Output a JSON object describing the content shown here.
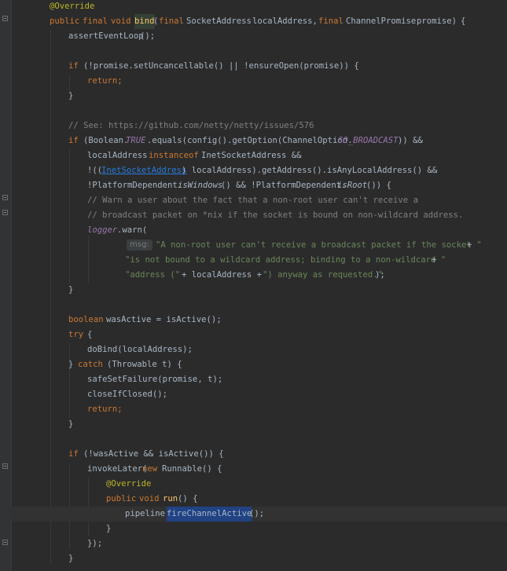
{
  "editor": {
    "l01": {
      "ann": "@Override"
    },
    "l02": {
      "kw_public": "public",
      "kw_final": "final",
      "kw_void": "void",
      "method": "bind",
      "paren": "(",
      "kw_final2": "final",
      "type1": "SocketAddress",
      "param1": "localAddress,",
      "kw_final3": "final",
      "type2": "ChannelPromise",
      "param2": "promise)",
      "brace": "{"
    },
    "l03": {
      "text": "assertEventLoop",
      "tail": "();"
    },
    "l05": {
      "kw_if": "if",
      "text": "(!promise.setUncancellable() || !ensureOpen(promise)) {"
    },
    "l06": {
      "kw_return": "return;"
    },
    "l07": {
      "brace": "}"
    },
    "l09": {
      "comment": "// See: https://github.com/netty/netty/issues/576"
    },
    "l10": {
      "kw_if": "if",
      "p1": "(Boolean.",
      "const1": "TRUE",
      "p2": ".equals(config().getOption(ChannelOption.",
      "const2": "SO_BROADCAST",
      "p3": ")) &&"
    },
    "l11": {
      "p1": "localAddress",
      "kw": "instanceof",
      "p2": "InetSocketAddress &&"
    },
    "l12": {
      "p1": "!((",
      "link": "InetSocketAddress",
      "p2": ") localAddress).getAddress().isAnyLocalAddress() &&"
    },
    "l13": {
      "p1": "!PlatformDependent.",
      "m1": "isWindows",
      "p2": "() && !PlatformDependent.",
      "m2": "isRoot",
      "p3": "()) {"
    },
    "l14": {
      "comment": "// Warn a user about the fact that a non-root user can't receive a"
    },
    "l15": {
      "comment": "// broadcast packet on *nix if the socket is bound on non-wildcard address."
    },
    "l16": {
      "field": "logger",
      "p1": ".warn("
    },
    "l17": {
      "hint": "msg:",
      "str": "\"A non-root user can't receive a broadcast packet if the socket \"",
      "op": "+"
    },
    "l18": {
      "str": "\"is not bound to a wildcard address; binding to a non-wildcard \"",
      "op": "+"
    },
    "l19": {
      "str1": "\"address (\"",
      "mid": "+ localAddress +",
      "str2": "\") anyway as requested.\"",
      "end": ");"
    },
    "l20": {
      "brace": "}"
    },
    "l22": {
      "kw": "boolean",
      "text": "wasActive = isActive();"
    },
    "l23": {
      "kw": "try",
      "brace": "{"
    },
    "l24": {
      "text": "doBind(localAddress);"
    },
    "l25": {
      "p1": "}",
      "kw": "catch",
      "p2": "(Throwable t) {"
    },
    "l26": {
      "text": "safeSetFailure(promise, t);"
    },
    "l27": {
      "text": "closeIfClosed();"
    },
    "l28": {
      "kw": "return;"
    },
    "l29": {
      "brace": "}"
    },
    "l31": {
      "kw_if": "if",
      "text": "(!wasActive && isActive()) {"
    },
    "l32": {
      "p1": "invokeLater(",
      "kw": "new",
      "p2": "Runnable() {"
    },
    "l33": {
      "ann": "@Override"
    },
    "l34": {
      "kw_public": "public",
      "kw_void": "void",
      "method": "run",
      "p1": "() {"
    },
    "l35": {
      "p1": "pipeline.",
      "sel": "fireChannelActive",
      "p2": "();"
    },
    "l36": {
      "brace": "}"
    },
    "l37": {
      "text": "});"
    },
    "l38": {
      "brace": "}"
    }
  },
  "colors": {
    "background": "#2b2b2b",
    "keyword": "#cc7832",
    "annotation": "#bbb529",
    "method_decl": "#ffc66d",
    "string": "#6a8759",
    "comment": "#808080",
    "field": "#9876aa",
    "link": "#287bde",
    "selection": "#214283"
  }
}
